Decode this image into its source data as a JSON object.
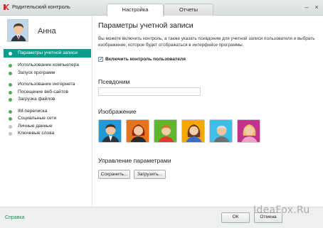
{
  "window": {
    "title": "Родительский контроль",
    "tabs": [
      {
        "label": "Настройка",
        "active": true
      },
      {
        "label": "Отчеты",
        "active": false
      }
    ],
    "minimize": "–",
    "close": "×"
  },
  "user": {
    "name": "Анна"
  },
  "sidebar": {
    "items": [
      {
        "label": "Параметры учетной записи",
        "active": true
      },
      {
        "label": "Использование компьютера",
        "status": "green"
      },
      {
        "label": "Запуск программ",
        "status": "green"
      },
      {
        "label": "Использование интернета",
        "status": "green"
      },
      {
        "label": "Посещение веб-сайтов",
        "status": "green"
      },
      {
        "label": "Загрузка файлов",
        "status": "green"
      },
      {
        "label": "IM-переписка",
        "status": "green"
      },
      {
        "label": "Социальные сети",
        "status": "green"
      },
      {
        "label": "Личные данные",
        "status": "grey"
      },
      {
        "label": "Ключевые слова",
        "status": "grey"
      }
    ]
  },
  "main": {
    "title": "Параметры учетной записи",
    "description": "Вы можете включить контроль, а также указать псевдоним для учетной записи пользователя и выбрать изображение, которое будет отображаться в интерфейсе программы.",
    "enable_control": {
      "label": "Включить контроль пользователя",
      "checked": true,
      "mark": "✓"
    },
    "nickname": {
      "heading": "Псевдоним",
      "value": ""
    },
    "image": {
      "heading": "Изображение",
      "avatars": [
        {
          "name": "man-suit",
          "bg": "#1f9ad6"
        },
        {
          "name": "woman-red-hair",
          "bg": "#e8731c"
        },
        {
          "name": "boy",
          "bg": "#5eb82d"
        },
        {
          "name": "girl",
          "bg": "#f5a800"
        },
        {
          "name": "elder-man",
          "bg": "#3dbfe8"
        },
        {
          "name": "woman-pink",
          "bg": "#c2328e"
        }
      ]
    },
    "settings": {
      "heading": "Управление параметрами",
      "save_label": "Сохранить...",
      "load_label": "Загрузить..."
    }
  },
  "footer": {
    "help": "Справка",
    "ok": "ОК",
    "cancel": "Отмена"
  },
  "watermark": "IdeaFox.Ru",
  "colors": {
    "accent": "#0b9c8c",
    "status_green": "#4caf50",
    "status_grey": "#bfc3c3"
  }
}
